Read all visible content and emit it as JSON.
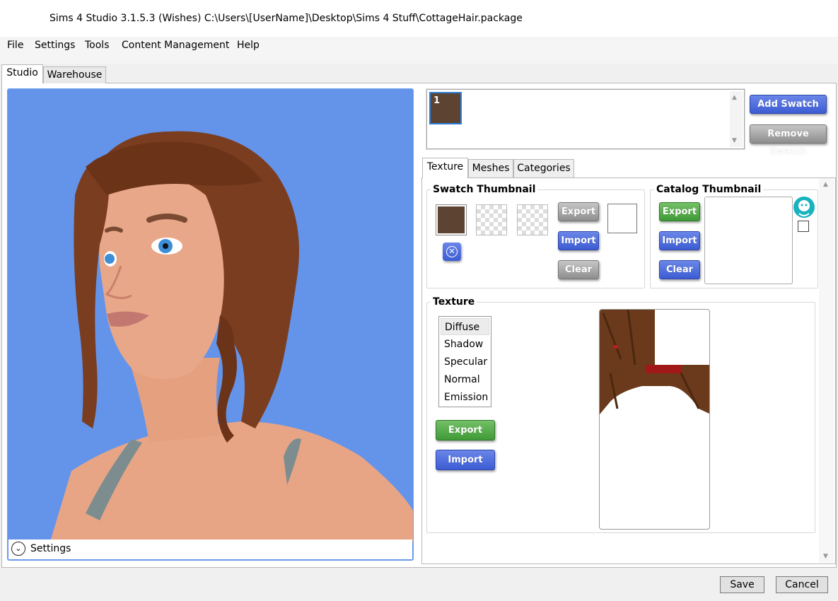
{
  "window": {
    "title": "Sims 4 Studio 3.1.5.3 (Wishes)  C:\\Users\\[UserName]\\Desktop\\Sims 4 Stuff\\CottageHair.package"
  },
  "menu": [
    "File",
    "Settings",
    "Tools",
    "Content Management",
    "Help"
  ],
  "tabs": {
    "studio": "Studio",
    "warehouse": "Warehouse"
  },
  "viewport": {
    "settings_label": "Settings",
    "background_color": "#6494ea"
  },
  "swatches": {
    "items": [
      {
        "number": "1",
        "color": "#5c4332"
      }
    ],
    "add_label": "Add Swatch",
    "remove_label": "Remove Swatch"
  },
  "subtabs": {
    "texture": "Texture",
    "meshes": "Meshes",
    "categories": "Categories"
  },
  "swatch_thumbnail": {
    "title": "Swatch Thumbnail",
    "export_label": "Export",
    "import_label": "Import",
    "clear_label": "Clear"
  },
  "catalog_thumbnail": {
    "title": "Catalog Thumbnail",
    "export_label": "Export",
    "import_label": "Import",
    "clear_label": "Clear"
  },
  "texture": {
    "title": "Texture",
    "types": [
      "Diffuse",
      "Shadow",
      "Specular",
      "Normal",
      "Emission"
    ],
    "selected": "Diffuse",
    "export_label": "Export",
    "import_label": "Import"
  },
  "footer": {
    "save_label": "Save",
    "cancel_label": "Cancel"
  },
  "colors": {
    "accent_blue": "#3c5cd3",
    "accent_green": "#3f9a37",
    "selection_border": "#2d7fd6"
  }
}
